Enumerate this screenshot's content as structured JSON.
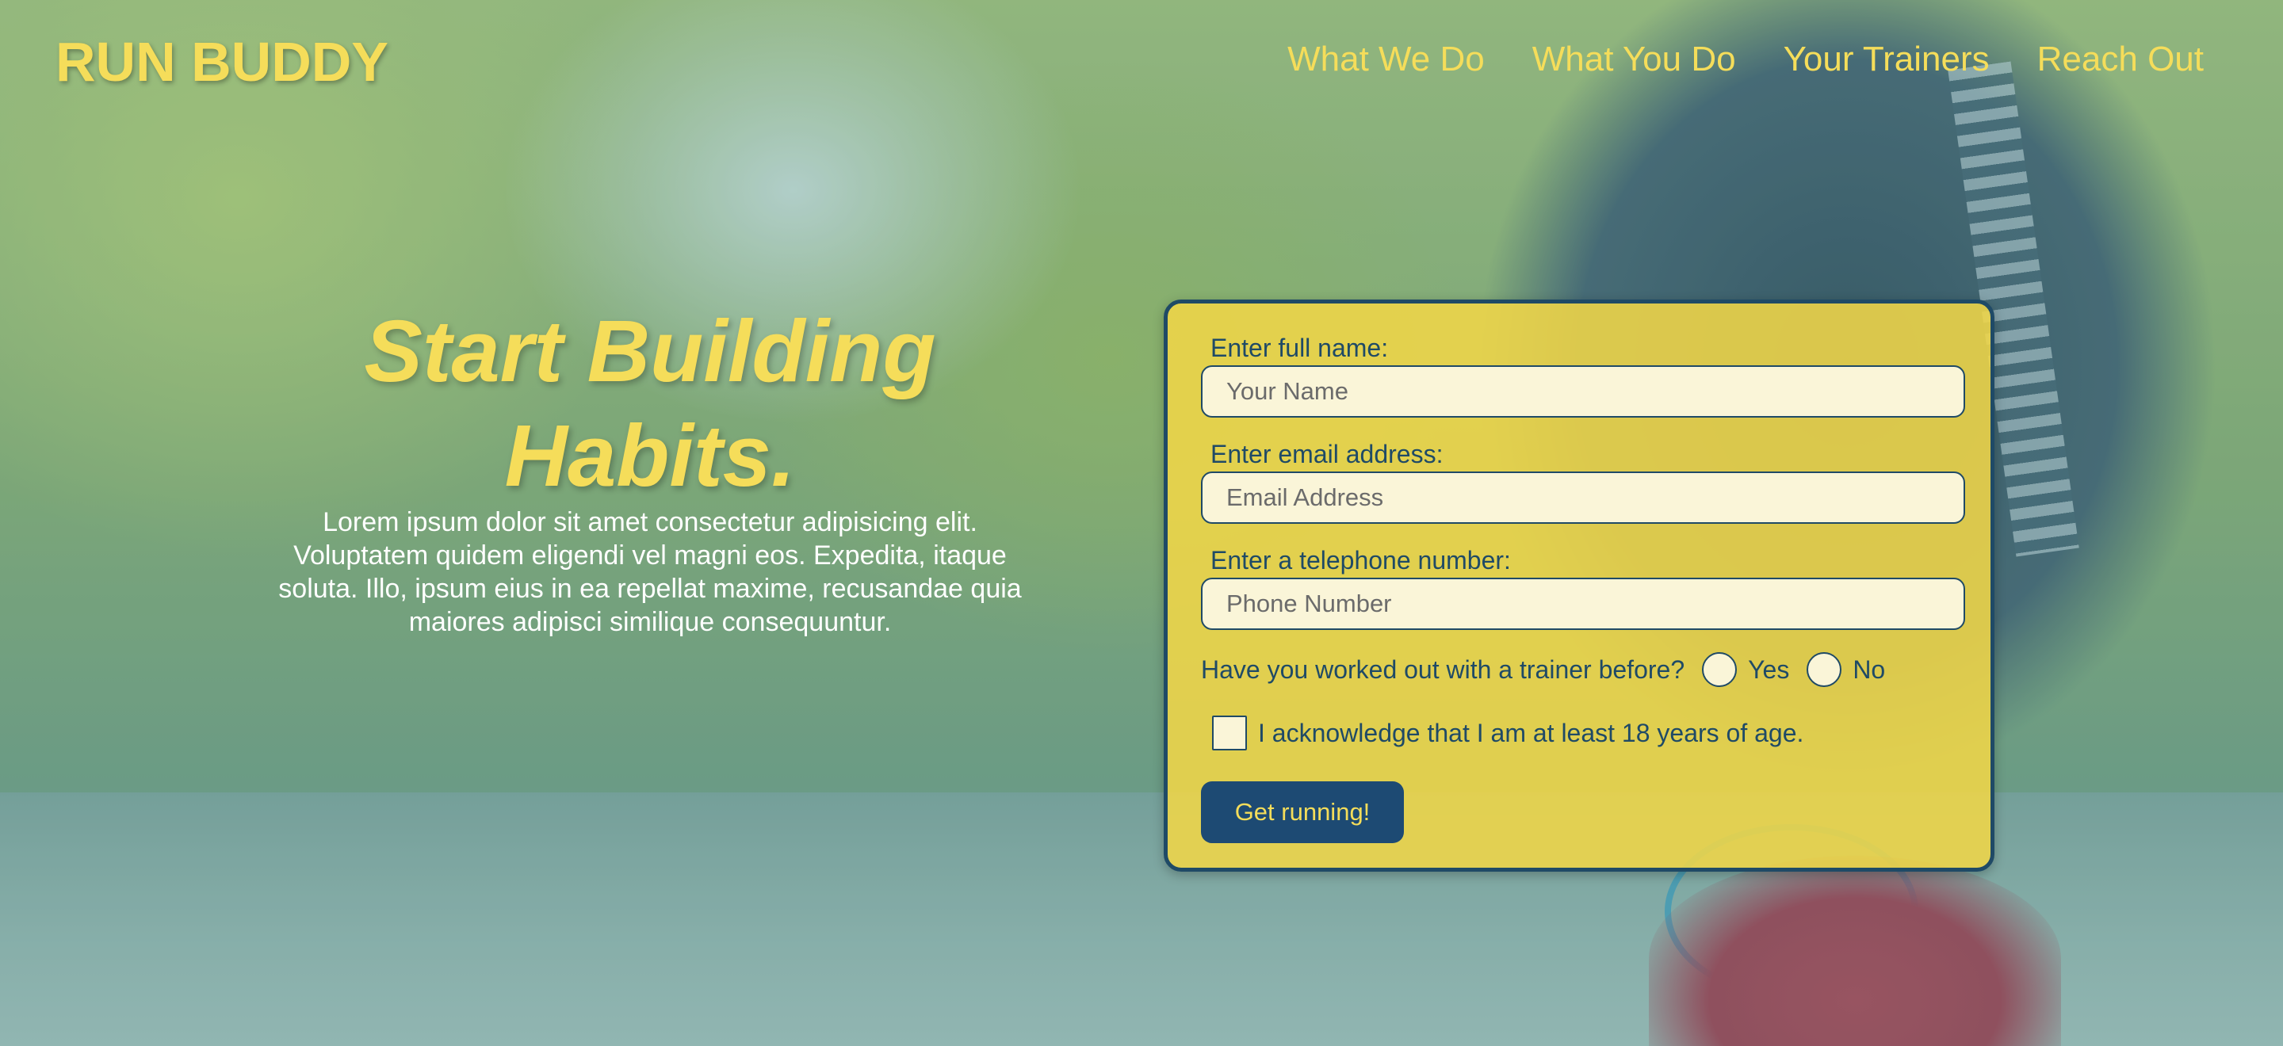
{
  "header": {
    "logo": "RUN BUDDY",
    "nav": [
      {
        "label": "What We Do"
      },
      {
        "label": "What You Do"
      },
      {
        "label": "Your Trainers"
      },
      {
        "label": "Reach Out"
      }
    ]
  },
  "hero": {
    "title_line1": "Start Building",
    "title_line2": "Habits.",
    "body": "Lorem ipsum dolor sit amet consectetur adipisicing elit. Voluptatem quidem eligendi vel magni eos. Expedita, itaque soluta. Illo, ipsum eius in ea repellat maxime, recusandae quia maiores adipisci similique consequuntur."
  },
  "form": {
    "name_label": "Enter full name:",
    "name_placeholder": "Your Name",
    "email_label": "Enter email address:",
    "email_placeholder": "Email Address",
    "phone_label": "Enter a telephone number:",
    "phone_placeholder": "Phone Number",
    "trainer_question": "Have you worked out with a trainer before?",
    "yes_label": "Yes",
    "no_label": "No",
    "age_ack": "I acknowledge that I am at least 18 years of age.",
    "submit_label": "Get running!"
  },
  "colors": {
    "accent_yellow": "#f5dd5a",
    "navy": "#1f4a66",
    "button_bg": "#1d4a73"
  }
}
